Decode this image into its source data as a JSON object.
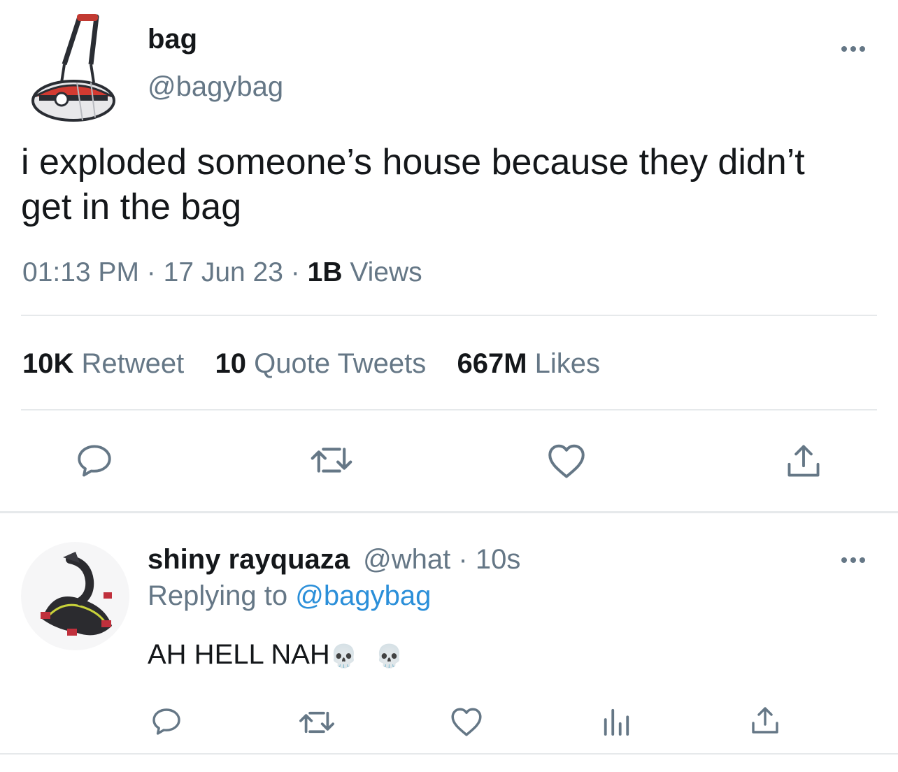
{
  "tweet": {
    "display_name": "bag",
    "handle": "@bagybag",
    "text_line1": "i exploded someone’s house because they didn’t",
    "text_line2": "get in the bag",
    "time": "01:13 PM",
    "sep1": "·",
    "date": "17 Jun 23",
    "sep2": "·",
    "views_count": "1B",
    "views_label": "Views",
    "retweet_count": "10K",
    "retweet_label": "Retweet",
    "quote_count": "10",
    "quote_label": "Quote Tweets",
    "likes_count": "667M",
    "likes_label": "Likes"
  },
  "reply": {
    "display_name": "shiny rayquaza",
    "handle": "@what",
    "sep": "·",
    "time": "10s",
    "replying_prefix": "Replying to",
    "replying_handle": "@bagybag",
    "text": "AH HELL NAH",
    "emoji1": "💀",
    "emoji2": "💀"
  },
  "icons": {
    "more": "more-horizontal-icon",
    "reply": "comment-bubble-icon",
    "retweet": "retweet-icon",
    "like": "heart-icon",
    "share": "share-upload-icon",
    "analytics": "bar-chart-icon"
  },
  "colors": {
    "text": "#14171a",
    "muted": "#657786",
    "link": "#2b8fd9",
    "divider": "#e6e9eb"
  }
}
